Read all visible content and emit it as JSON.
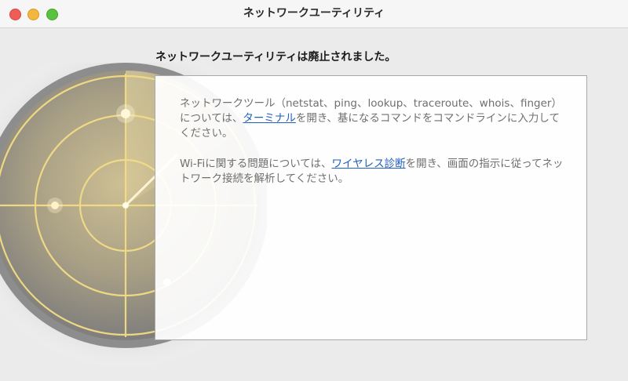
{
  "window": {
    "title": "ネットワークユーティリティ"
  },
  "main": {
    "heading": "ネットワークユーティリティは廃止されました。",
    "paragraph1": {
      "before": "ネットワークツール（netstat、ping、lookup、traceroute、whois、finger）については、",
      "link": "ターミナル",
      "after": "を開き、基になるコマンドをコマンドラインに入力してください。"
    },
    "paragraph2": {
      "before": "Wi-Fiに関する問題については、",
      "link": "ワイヤレス診断",
      "after": "を開き、画面の指示に従ってネットワーク接続を解析してください。"
    }
  },
  "icons": {
    "app_icon": "radar-icon"
  },
  "colors": {
    "link": "#1f5fbf",
    "text": "#6f6f6f",
    "heading": "#1a1a1a",
    "radar_line": "#f3dc86"
  }
}
